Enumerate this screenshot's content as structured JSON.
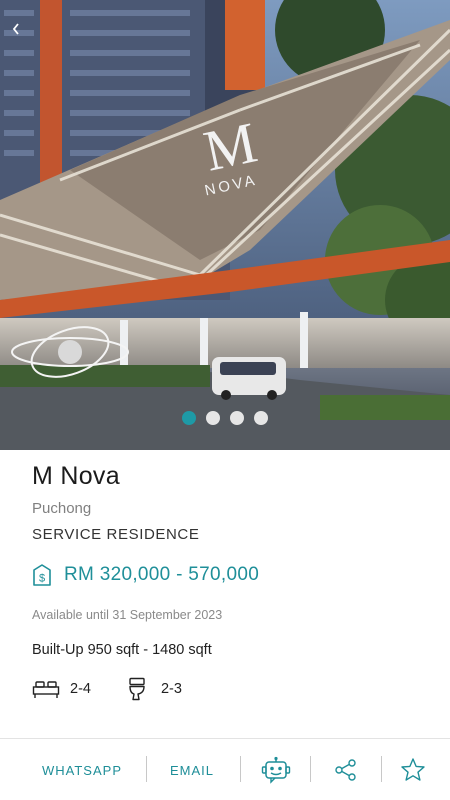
{
  "hero": {
    "logo_letter": "M",
    "logo_word": "NOVA",
    "carousel": {
      "count": 4,
      "active_index": 0
    }
  },
  "property": {
    "name": "M Nova",
    "location": "Puchong",
    "type": "SERVICE RESIDENCE",
    "price": "RM 320,000 - 570,000",
    "availability": "Available until 31 September 2023",
    "built_up": "Built-Up 950 sqft - 1480 sqft",
    "bedrooms": "2-4",
    "bathrooms": "2-3"
  },
  "actions": {
    "whatsapp": "WHATSAPP",
    "email": "EMAIL"
  },
  "colors": {
    "accent": "#1e9aa6",
    "price": "#1f8f99"
  },
  "icons": {
    "back": "chevron-left-icon",
    "price": "dollar-tag-icon",
    "bed": "bed-icon",
    "bath": "toilet-icon",
    "chatbot": "robot-icon",
    "share": "share-icon",
    "favourite": "star-icon"
  }
}
